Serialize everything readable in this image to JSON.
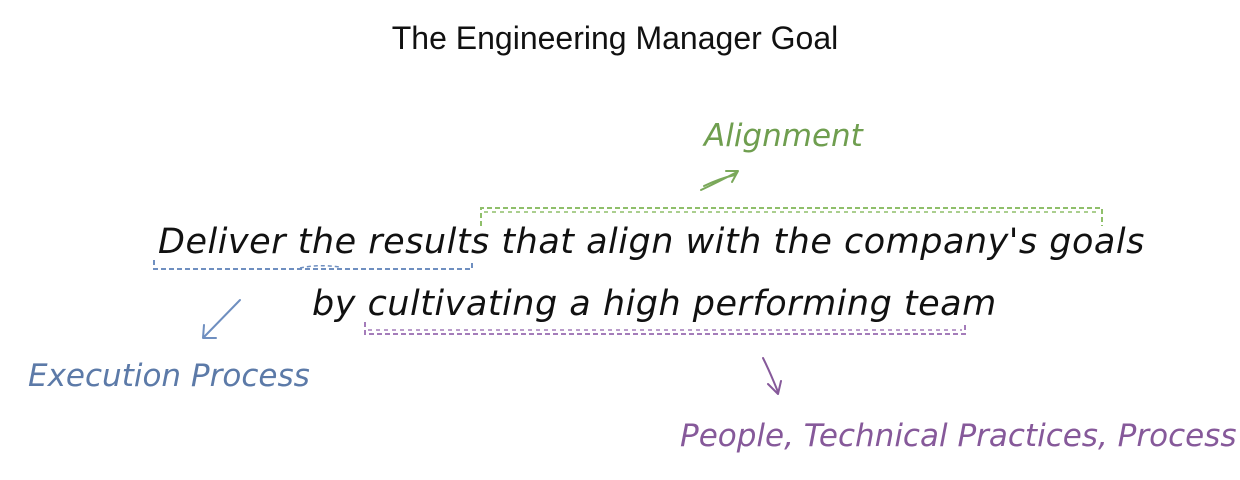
{
  "title": "The Engineering Manager Goal",
  "statement": {
    "line1_part1": "Deliver the results",
    "line1_part2": " that align with the company's goals",
    "line2_part1": "by",
    "line2_part2": " cultivating a high performing team"
  },
  "annotations": {
    "alignment": {
      "label": "Alignment",
      "color": "#6f9e4f"
    },
    "execution": {
      "label": "Execution Process",
      "color": "#5c7aa8"
    },
    "people": {
      "label": "People, Technical Practices, Process",
      "color": "#86599a"
    }
  }
}
